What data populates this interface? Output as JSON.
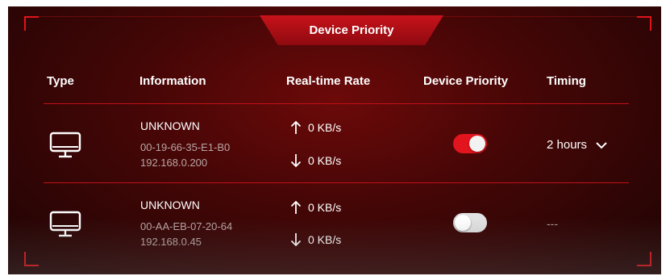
{
  "title": "Device Priority",
  "columns": {
    "type": "Type",
    "information": "Information",
    "rate": "Real-time Rate",
    "priority": "Device Priority",
    "timing": "Timing"
  },
  "devices": [
    {
      "name": "UNKNOWN",
      "mac": "00-19-66-35-E1-B0",
      "ip": "192.168.0.200",
      "upload": "0 KB/s",
      "download": "0 KB/s",
      "priority_on": true,
      "timing": "2 hours"
    },
    {
      "name": "UNKNOWN",
      "mac": "00-AA-EB-07-20-64",
      "ip": "192.168.0.45",
      "upload": "0 KB/s",
      "download": "0 KB/s",
      "priority_on": false,
      "timing": "---"
    }
  ],
  "colors": {
    "accent": "#e2141d",
    "toggle_off": "#e2e2e2"
  },
  "icons": [
    "monitor-icon",
    "arrow-up-icon",
    "arrow-down-icon",
    "chevron-down-icon"
  ]
}
